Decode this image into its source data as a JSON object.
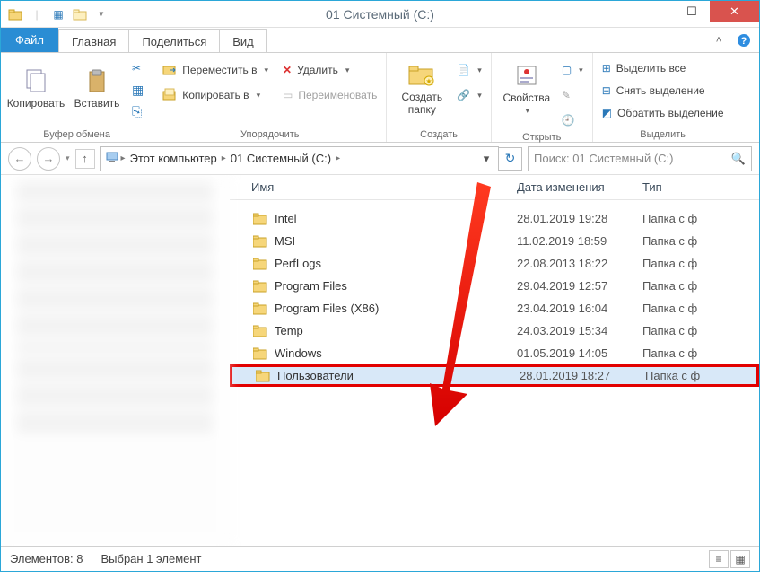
{
  "window": {
    "title": "01 Системный (С:)"
  },
  "tabs": {
    "file": "Файл",
    "items": [
      "Главная",
      "Поделиться",
      "Вид"
    ]
  },
  "ribbon": {
    "clipboard": {
      "copy": "Копировать",
      "paste": "Вставить",
      "label": "Буфер обмена"
    },
    "organize": {
      "move_to": "Переместить в",
      "copy_to": "Копировать в",
      "delete": "Удалить",
      "rename": "Переименовать",
      "label": "Упорядочить"
    },
    "new": {
      "new_folder_l1": "Создать",
      "new_folder_l2": "папку",
      "label": "Создать"
    },
    "open": {
      "properties": "Свойства",
      "label": "Открыть"
    },
    "select": {
      "select_all": "Выделить все",
      "select_none": "Снять выделение",
      "invert": "Обратить выделение",
      "label": "Выделить"
    }
  },
  "nav": {
    "crumbs": [
      "Этот компьютер",
      "01 Системный (С:)"
    ],
    "search_placeholder": "Поиск: 01 Системный (С:)"
  },
  "columns": {
    "name": "Имя",
    "date": "Дата изменения",
    "type": "Тип"
  },
  "files": [
    {
      "name": "Intel",
      "date": "28.01.2019 19:28",
      "type": "Папка с ф"
    },
    {
      "name": "MSI",
      "date": "11.02.2019 18:59",
      "type": "Папка с ф"
    },
    {
      "name": "PerfLogs",
      "date": "22.08.2013 18:22",
      "type": "Папка с ф"
    },
    {
      "name": "Program Files",
      "date": "29.04.2019 12:57",
      "type": "Папка с ф"
    },
    {
      "name": "Program Files (X86)",
      "date": "23.04.2019 16:04",
      "type": "Папка с ф"
    },
    {
      "name": "Temp",
      "date": "24.03.2019 15:34",
      "type": "Папка с ф"
    },
    {
      "name": "Windows",
      "date": "01.05.2019 14:05",
      "type": "Папка с ф"
    },
    {
      "name": "Пользователи",
      "date": "28.01.2019 18:27",
      "type": "Папка с ф"
    }
  ],
  "status": {
    "items": "Элементов: 8",
    "selected": "Выбран 1 элемент"
  },
  "highlight_index": 7
}
